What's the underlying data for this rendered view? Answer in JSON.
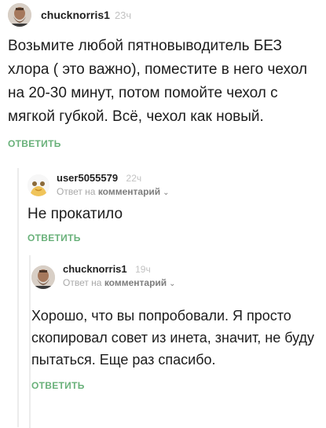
{
  "comments": [
    {
      "author": "chucknorris1",
      "time": "23ч",
      "text": "Возьмите любой пятновыводитель БЕЗ хлора ( это важно), поместите в него чехол на 20-30 минут, потом помойте чехол с мягкой губкой. Всё, чехол как новый.",
      "reply_label": "ОТВЕТИТЬ",
      "avatar_icon": "bearded-man-avatar-icon"
    },
    {
      "author": "user5055579",
      "time": "22ч",
      "reply_prefix": "Ответ на",
      "reply_target": "комментарий",
      "text": "Не прокатило",
      "reply_label": "ОТВЕТИТЬ",
      "avatar_icon": "default-avatar-icon"
    },
    {
      "author": "chucknorris1",
      "time": "19ч",
      "reply_prefix": "Ответ на",
      "reply_target": "комментарий",
      "text": "Хорошо, что вы попробовали. Я просто скопировал совет из инета, значит, не буду пытаться. Еще раз спасибо.",
      "reply_label": "ОТВЕТИТЬ",
      "avatar_icon": "bearded-man-avatar-icon"
    }
  ],
  "colors": {
    "accent": "#69b17a",
    "time": "#c2c2c2",
    "muted": "#a9a9a9"
  }
}
